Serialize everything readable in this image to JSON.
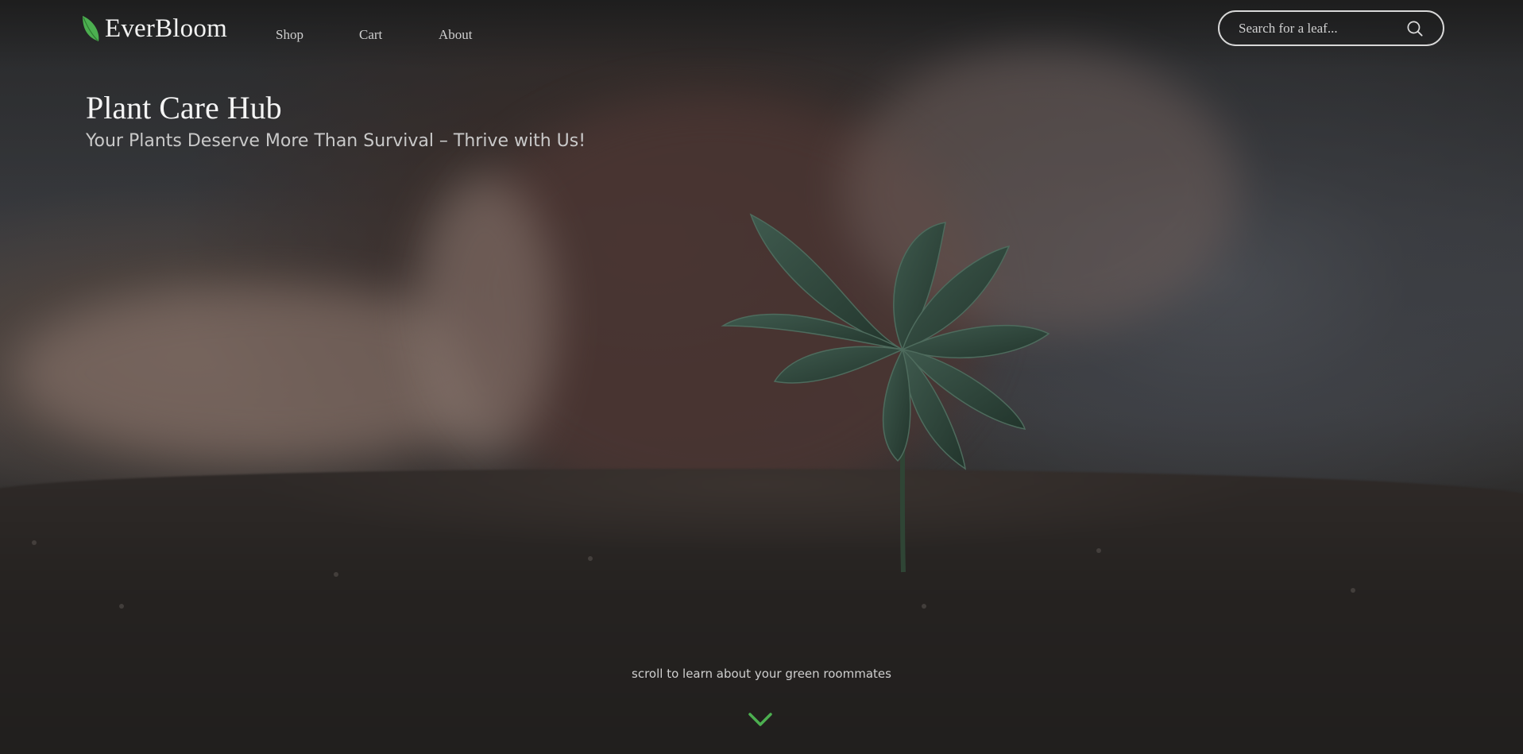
{
  "brand": {
    "name": "EverBloom",
    "accent_color": "#4caf50"
  },
  "nav": {
    "items": [
      {
        "label": "Shop"
      },
      {
        "label": "Cart"
      },
      {
        "label": "About"
      }
    ]
  },
  "search": {
    "placeholder": "Search for a leaf...",
    "icon": "search-icon"
  },
  "hero": {
    "title": "Plant Care Hub",
    "subtitle": "Your Plants Deserve More Than Survival – Thrive with Us!",
    "scroll_hint": "scroll to learn about your green roommates",
    "scroll_icon": "chevron-down-icon"
  }
}
